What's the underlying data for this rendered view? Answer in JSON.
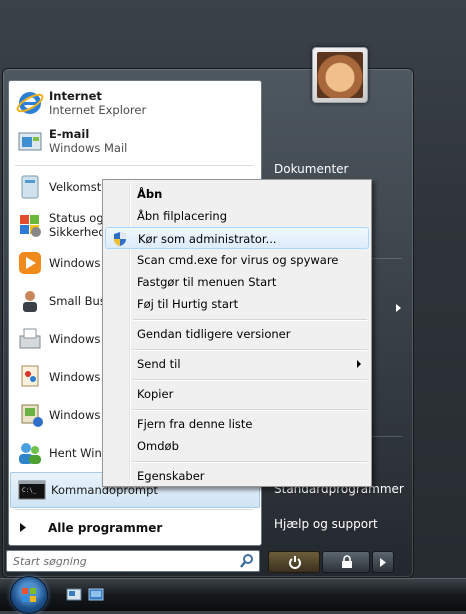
{
  "start_menu": {
    "pinned": [
      {
        "title": "Internet",
        "subtitle": "Internet Explorer",
        "icon": "internet-explorer-icon"
      },
      {
        "title": "E-mail",
        "subtitle": "Windows Mail",
        "icon": "windows-mail-icon"
      }
    ],
    "recent": [
      {
        "label": "Velkomst",
        "icon": "welcome-center-icon"
      },
      {
        "label": "Status og",
        "label2": "Sikkerhed",
        "icon": "security-center-icon"
      },
      {
        "label": "Windows",
        "icon": "windows-media-player-icon"
      },
      {
        "label": "Small Bus",
        "icon": "small-business-icon"
      },
      {
        "label": "Windows",
        "icon": "windows-fax-icon"
      },
      {
        "label": "Windows",
        "icon": "windows-paint-icon"
      },
      {
        "label": "Windows",
        "icon": "windows-gallery-icon"
      },
      {
        "label": "Hent Wind",
        "icon": "windows-contacts-icon"
      },
      {
        "label": "Kommandoprompt",
        "icon": "command-prompt-icon"
      }
    ],
    "all_programs": "Alle programmer",
    "search_placeholder": "Start søgning",
    "right_pane": {
      "documents": "Dokumenter",
      "default_programs": "Standardprogrammer",
      "help": "Hjælp og support"
    }
  },
  "context_menu": {
    "items": [
      {
        "label": "Åbn",
        "bold": true
      },
      {
        "label": "Åbn filplacering"
      },
      {
        "label": "Kør som administrator...",
        "highlighted": true,
        "icon": "uac-shield-icon"
      },
      {
        "label": "Scan cmd.exe for virus og spyware"
      },
      {
        "label": "Fastgør til menuen Start"
      },
      {
        "label": "Føj til Hurtig start"
      },
      {
        "label": "Gendan tidligere versioner"
      },
      {
        "label": "Send til",
        "submenu": true
      },
      {
        "label": "Kopier"
      },
      {
        "label": "Fjern fra denne liste"
      },
      {
        "label": "Omdøb"
      },
      {
        "label": "Egenskaber"
      }
    ]
  },
  "colors": {
    "highlight": "#dcebfc",
    "menu_bg": "#f0f0f0",
    "power_button": "#6c5e3a"
  }
}
